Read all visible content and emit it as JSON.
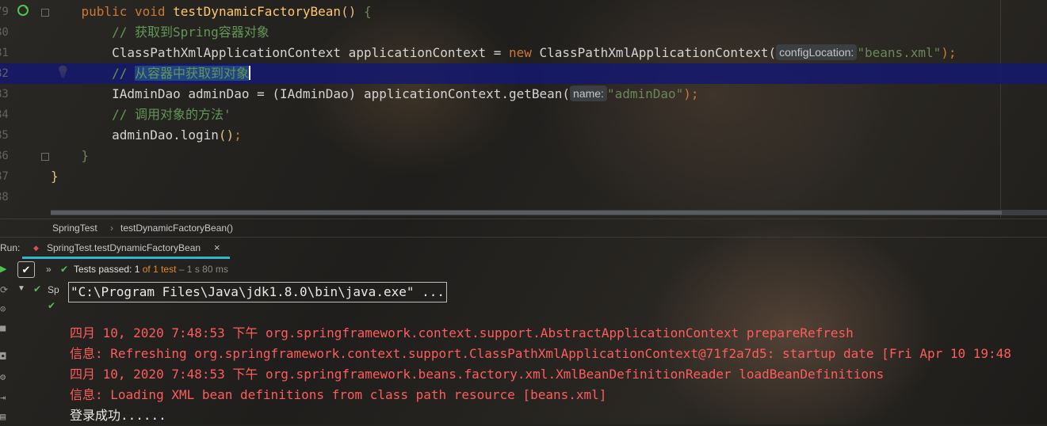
{
  "editor": {
    "line_numbers": [
      "79",
      "80",
      "81",
      "82",
      "83",
      "84",
      "85",
      "86",
      "87",
      "88"
    ],
    "method_signature": {
      "kw1": "public",
      "kw2": "void",
      "name": "testDynamicFactoryBean",
      "parens": "()",
      "brace": "{"
    },
    "comment1": "// 获取到Spring容器对象",
    "line81": {
      "type1": "ClassPathXmlApplicationContext",
      "var": " applicationContext = ",
      "new_kw": "new",
      "type2": " ClassPathXmlApplicationContext(",
      "hint": "configLocation:",
      "arg": "\"beans.xml\"",
      "end": ");"
    },
    "comment2_prefix": "// ",
    "comment2_selected": "从容器中获取到对象",
    "line83": {
      "code": "IAdminDao adminDao = (IAdminDao) applicationContext.getBean(",
      "hint": "name:",
      "arg": "\"adminDao\"",
      "end": ");"
    },
    "comment3": "// 调用对象的方法'",
    "line85": {
      "call": "adminDao.login",
      "parens": "()",
      "end": ";"
    },
    "closing_brace_inner": "}",
    "closing_brace_outer": "}"
  },
  "breadcrumb": {
    "class": "SpringTest",
    "separator": "›",
    "method": "testDynamicFactoryBean()"
  },
  "run_panel": {
    "label": "Run:",
    "tab_label": "SpringTest.testDynamicFactoryBean",
    "tab_close": "×",
    "tests_passed": "Tests passed:",
    "passed_count": "1",
    "of_total": "of 1 test",
    "duration": "– 1 s 80 ms",
    "tree_item": "Sp"
  },
  "console": {
    "command": "\"C:\\Program Files\\Java\\jdk1.8.0\\bin\\java.exe\" ...",
    "lines": [
      "四月 10, 2020 7:48:53 下午 org.springframework.context.support.AbstractApplicationContext prepareRefresh",
      "信息: Refreshing org.springframework.context.support.ClassPathXmlApplicationContext@71f2a7d5: startup date [Fri Apr 10 19:48",
      "四月 10, 2020 7:48:53 下午 org.springframework.beans.factory.xml.XmlBeanDefinitionReader loadBeanDefinitions",
      "信息: Loading XML bean definitions from class path resource [beans.xml]"
    ],
    "output": "登录成功......"
  },
  "colors": {
    "keyword": "#cc7832",
    "function": "#ffc66d",
    "comment": "#629755",
    "string": "#6a8759",
    "current_line": "#14196e",
    "error_text": "#ff5c5c",
    "accent_tab": "#36b3d0",
    "pass_green": "#5fb85f"
  }
}
